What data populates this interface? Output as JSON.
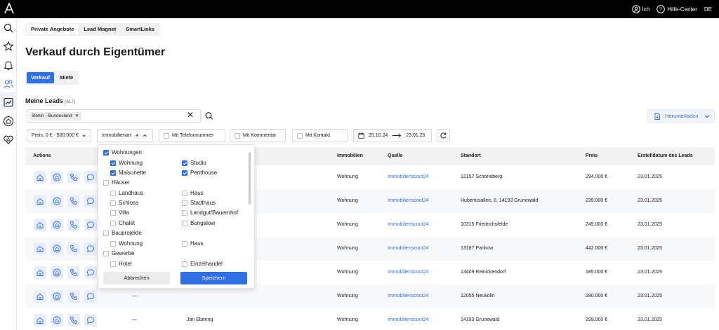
{
  "topbar": {
    "logo_icon": "a-logo-icon",
    "user_label": "Ich",
    "help_label": "Hilfe-Center",
    "language": "DE"
  },
  "sidebar": {
    "items": [
      "search-icon",
      "star-icon",
      "bell-icon",
      "users-icon",
      "chart-icon",
      "house-at-icon",
      "heart-house-icon"
    ],
    "active": "users-icon"
  },
  "tabs": [
    "Private Angebote",
    "Lead Magnet",
    "SmartLinks"
  ],
  "page_title": "Verkauf durch Eigentümer",
  "segment": {
    "options": [
      "Verkauf",
      "Miete"
    ],
    "active": "Verkauf"
  },
  "section": {
    "title": "Meine Leads",
    "count": "(617)"
  },
  "search": {
    "chip": "Berlin - Bundesland"
  },
  "download_label": "Herunterladen",
  "filters": {
    "price": "Preis: 0 € - 500.000 €",
    "property_type": "Immobilienart",
    "property_type_count": "4",
    "phone": "Mit Telefonnummer",
    "comment": "Mit Kommentar",
    "contact": "Mit Kontakt",
    "date_from": "25.10.24",
    "date_to": "23.01.25"
  },
  "table": {
    "headers": {
      "actions": "Actions",
      "immobilien": "Immobilien",
      "quelle": "Quelle",
      "standort": "Standort",
      "preis": "Preis",
      "datum": "Erstelldatum des Leads"
    },
    "rows": [
      {
        "c1": "",
        "c2": "",
        "immobilien": "Wohnung",
        "quelle": "Immobilienscout24",
        "standort": "12157 Schöneberg",
        "preis": "294.000 €",
        "datum": "23.01.2025"
      },
      {
        "c1": "",
        "c2": "",
        "immobilien": "Wohnung",
        "quelle": "Immobilienscout24",
        "standort": "Hubertusallee, 8, 14193 Grunewald",
        "preis": "239.000 €",
        "datum": "23.01.2025"
      },
      {
        "c1": "",
        "c2": "",
        "immobilien": "Wohnung",
        "quelle": "Immobilienscout24",
        "standort": "10315 Friedrichsfelde",
        "preis": "249.000 €",
        "datum": "23.01.2025"
      },
      {
        "c1": "",
        "c2": "",
        "immobilien": "Wohnung",
        "quelle": "Immobilienscout24",
        "standort": "13187 Pankow",
        "preis": "442.000 €",
        "datum": "23.01.2025"
      },
      {
        "c1": "",
        "c2": "",
        "immobilien": "Wohnung",
        "quelle": "Immobilienscout24",
        "standort": "13409 Reinickendorf",
        "preis": "185.000 €",
        "datum": "23.01.2025"
      },
      {
        "c1": "—",
        "c2": "",
        "immobilien": "Wohnung",
        "quelle": "Immobilienscout24",
        "standort": "12055 Neukölln",
        "preis": "280.000 €",
        "datum": "23.01.2025"
      },
      {
        "c1": "—",
        "c2": "Jan Ebering",
        "immobilien": "Wohnung",
        "quelle": "Immobilienscout24",
        "standort": "14193 Grunewald",
        "preis": "299.000 €",
        "datum": "23.01.2025"
      }
    ]
  },
  "dropdown": {
    "groups": {
      "wohnungen": "Wohnungen",
      "haeuser": "Häuser",
      "bauprojekte": "Bauprojekte",
      "gewerbe": "Gewerbe"
    },
    "options": {
      "wohnung": "Wohnung",
      "studio": "Studio",
      "maisonette": "Maisonette",
      "penthouse": "Penthouse",
      "landhaus": "Landhaus",
      "haus": "Haus",
      "schloss": "Schloss",
      "stadthaus": "Stadthaus",
      "villa": "Villa",
      "landgut": "Landgut/Bauernhof",
      "chalet": "Chalet",
      "bungalow": "Bungalow",
      "bp_wohnung": "Wohnung",
      "bp_haus": "Haus",
      "hotel": "Hotel",
      "einzelhandel": "Einzelhandel"
    },
    "cancel": "Abbrechen",
    "save": "Speichern"
  },
  "colors": {
    "accent": "#2f6fe4",
    "topbar": "#000000"
  }
}
